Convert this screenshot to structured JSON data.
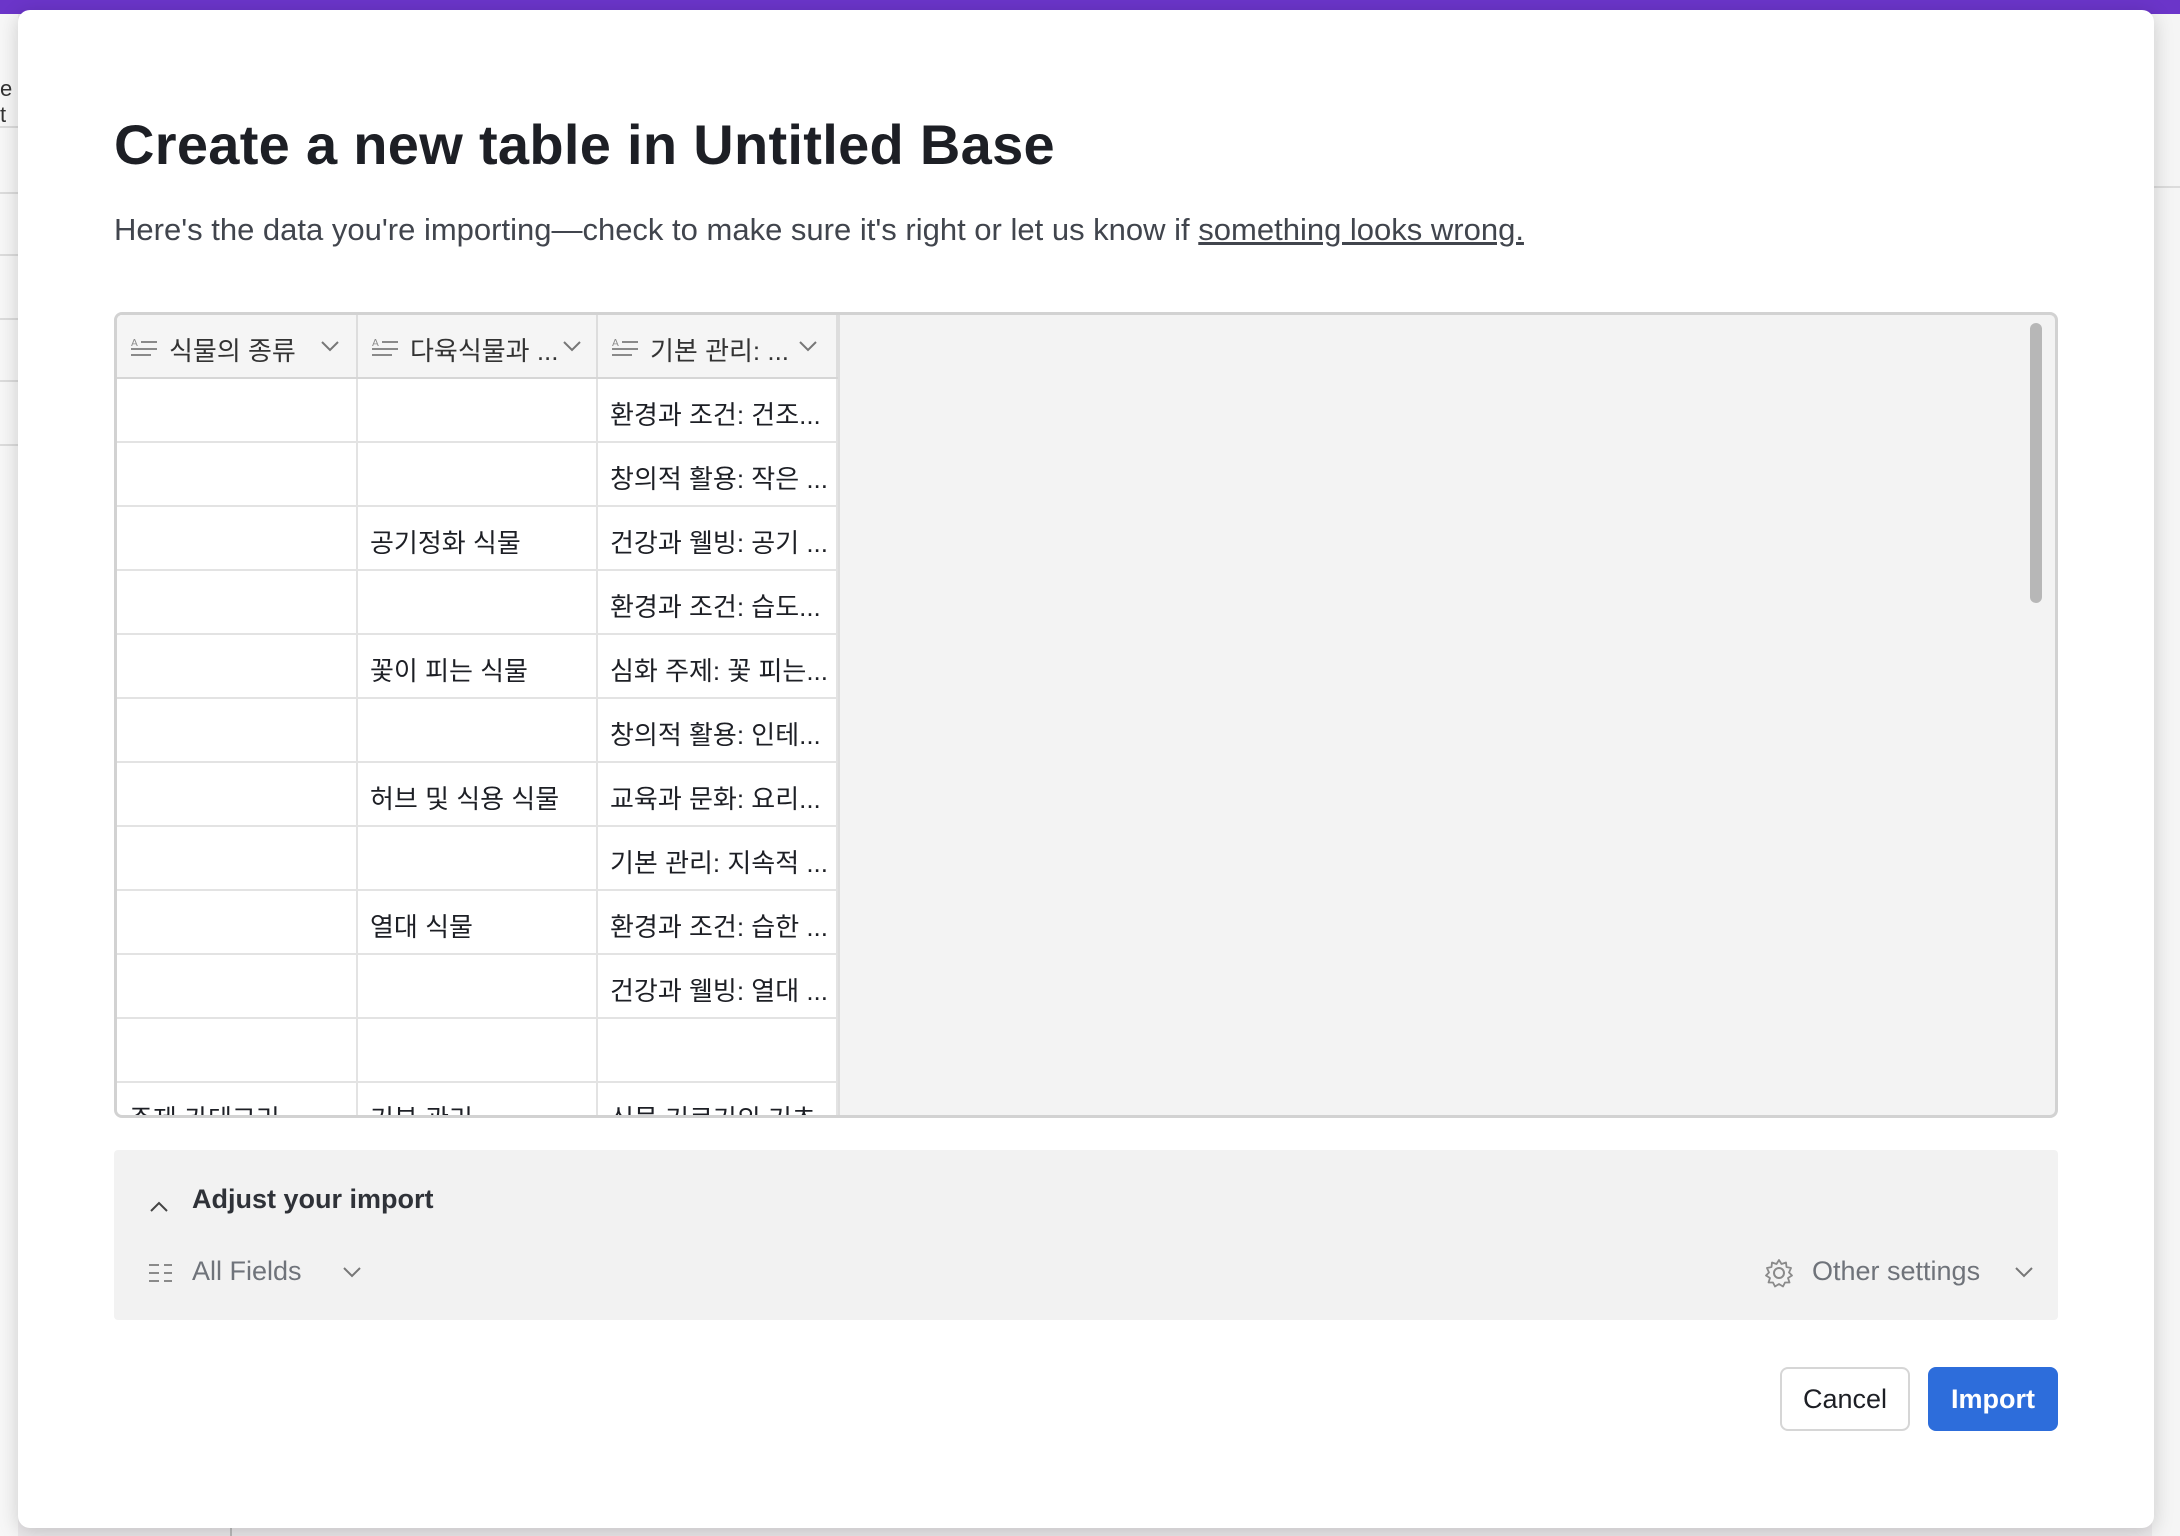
{
  "background": {
    "left_fragment": "e t"
  },
  "modal": {
    "title": "Create a new table in Untitled Base",
    "subtitle_prefix": "Here's the data you're importing—check to make sure it's right or let us know if ",
    "subtitle_link": "something looks wrong."
  },
  "table": {
    "columns": [
      {
        "label": "식물의 종류",
        "icon": "long-text-icon"
      },
      {
        "label": "다육식물과 ...",
        "icon": "long-text-icon"
      },
      {
        "label": "기본 관리: ...",
        "icon": "long-text-icon"
      }
    ],
    "rows": [
      [
        "",
        "",
        "환경과 조건: 건조..."
      ],
      [
        "",
        "",
        "창의적 활용: 작은 ..."
      ],
      [
        "",
        "공기정화 식물",
        "건강과 웰빙: 공기 ..."
      ],
      [
        "",
        "",
        "환경과 조건: 습도..."
      ],
      [
        "",
        "꽃이 피는 식물",
        "심화 주제: 꽃 피는..."
      ],
      [
        "",
        "",
        "창의적 활용: 인테..."
      ],
      [
        "",
        "허브 및 식용 식물",
        "교육과 문화: 요리..."
      ],
      [
        "",
        "",
        "기본 관리: 지속적 ..."
      ],
      [
        "",
        "열대 식물",
        "환경과 조건: 습한 ..."
      ],
      [
        "",
        "",
        "건강과 웰빙: 열대 ..."
      ],
      [
        "",
        "",
        ""
      ],
      [
        "주제 카테고리",
        "기본 관리",
        "식물 기르기의 기초"
      ]
    ]
  },
  "adjust": {
    "title": "Adjust your import",
    "fields_label": "All Fields",
    "settings_label": "Other settings"
  },
  "footer": {
    "cancel_label": "Cancel",
    "import_label": "Import"
  },
  "colors": {
    "top_bar": "#6b35c9",
    "primary": "#2d6ddb"
  }
}
